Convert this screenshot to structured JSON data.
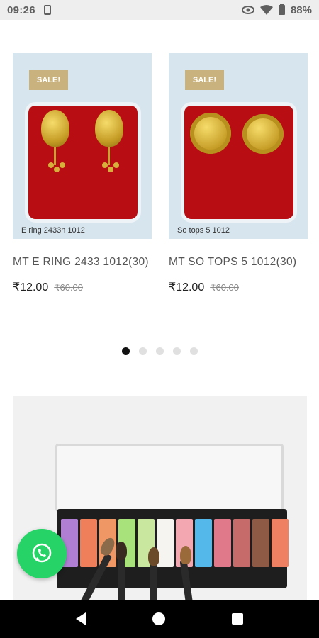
{
  "status_bar": {
    "time": "09:26",
    "battery": "88%"
  },
  "products": [
    {
      "sale_badge": "SALE!",
      "image_caption": "E ring 2433n 1012",
      "name": "MT E RING 2433 1012(30)",
      "price": "₹12.00",
      "old_price": "₹60.00"
    },
    {
      "sale_badge": "SALE!",
      "image_caption": "So tops 5 1012",
      "name": "MT SO TOPS 5 1012(30)",
      "price": "₹12.00",
      "old_price": "₹60.00"
    }
  ],
  "carousel": {
    "pages": 5,
    "active": 0
  },
  "colors": {
    "sale_badge": "#c9b27e",
    "whatsapp": "#25d366",
    "velvet": "#b80d13"
  },
  "icons": {
    "fab": "whatsapp-icon",
    "nav_back": "back-icon",
    "nav_home": "home-icon",
    "nav_recent": "recents-icon"
  }
}
